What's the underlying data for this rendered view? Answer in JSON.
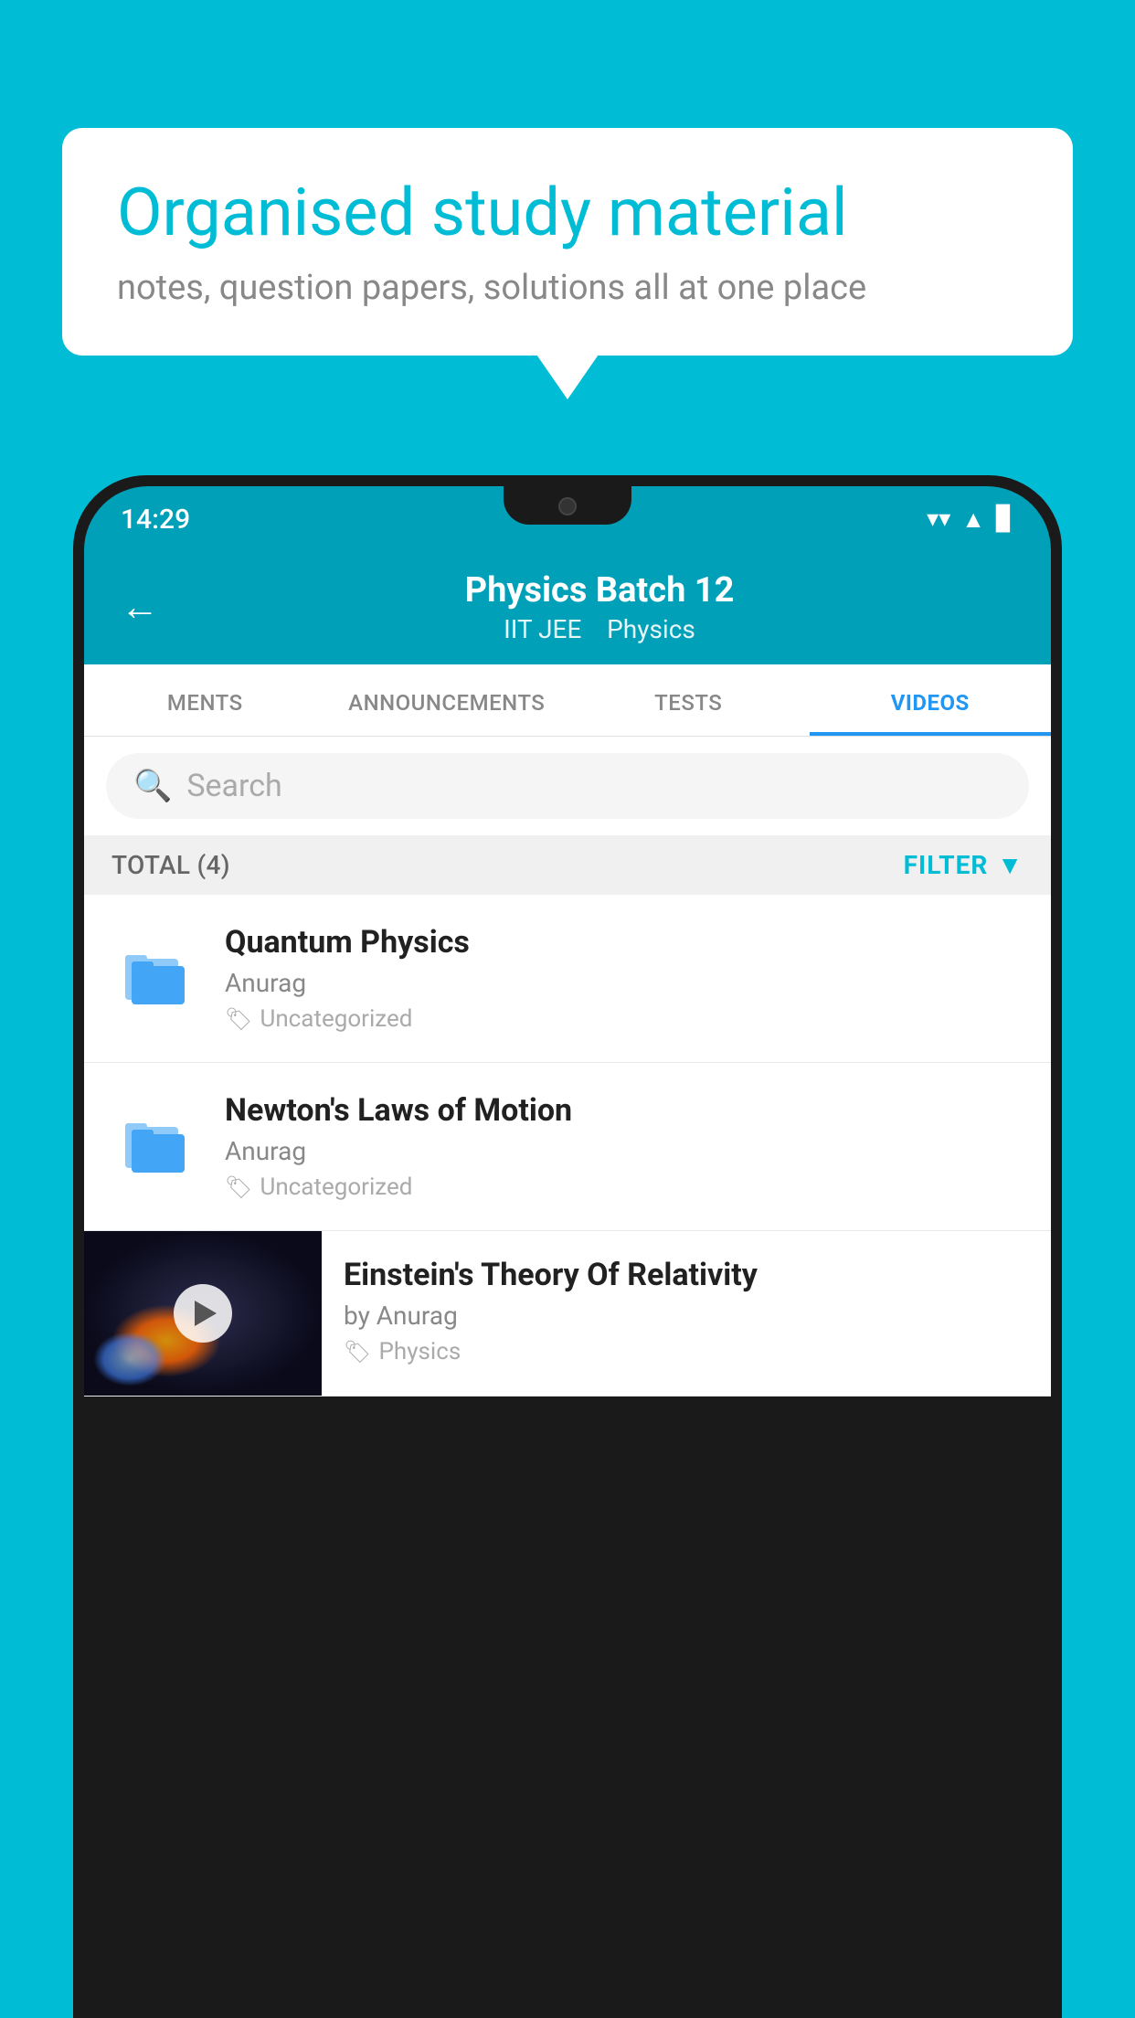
{
  "background_color": "#00bcd4",
  "speech_bubble": {
    "title": "Organised study material",
    "subtitle": "notes, question papers, solutions all at one place"
  },
  "status_bar": {
    "time": "14:29",
    "wifi": "▲",
    "signal": "▲",
    "battery": "▊"
  },
  "app_header": {
    "back_label": "←",
    "main_title": "Physics Batch 12",
    "sub_title_1": "IIT JEE",
    "sub_title_2": "Physics"
  },
  "tabs": [
    {
      "label": "MENTS",
      "active": false
    },
    {
      "label": "ANNOUNCEMENTS",
      "active": false
    },
    {
      "label": "TESTS",
      "active": false
    },
    {
      "label": "VIDEOS",
      "active": true
    }
  ],
  "search": {
    "placeholder": "Search"
  },
  "filter_row": {
    "total_label": "TOTAL (4)",
    "filter_label": "FILTER"
  },
  "videos": [
    {
      "id": 1,
      "title": "Quantum Physics",
      "author": "Anurag",
      "tag": "Uncategorized",
      "has_thumbnail": false
    },
    {
      "id": 2,
      "title": "Newton's Laws of Motion",
      "author": "Anurag",
      "tag": "Uncategorized",
      "has_thumbnail": false
    },
    {
      "id": 3,
      "title": "Einstein's Theory Of Relativity",
      "author": "by Anurag",
      "tag": "Physics",
      "has_thumbnail": true
    }
  ]
}
